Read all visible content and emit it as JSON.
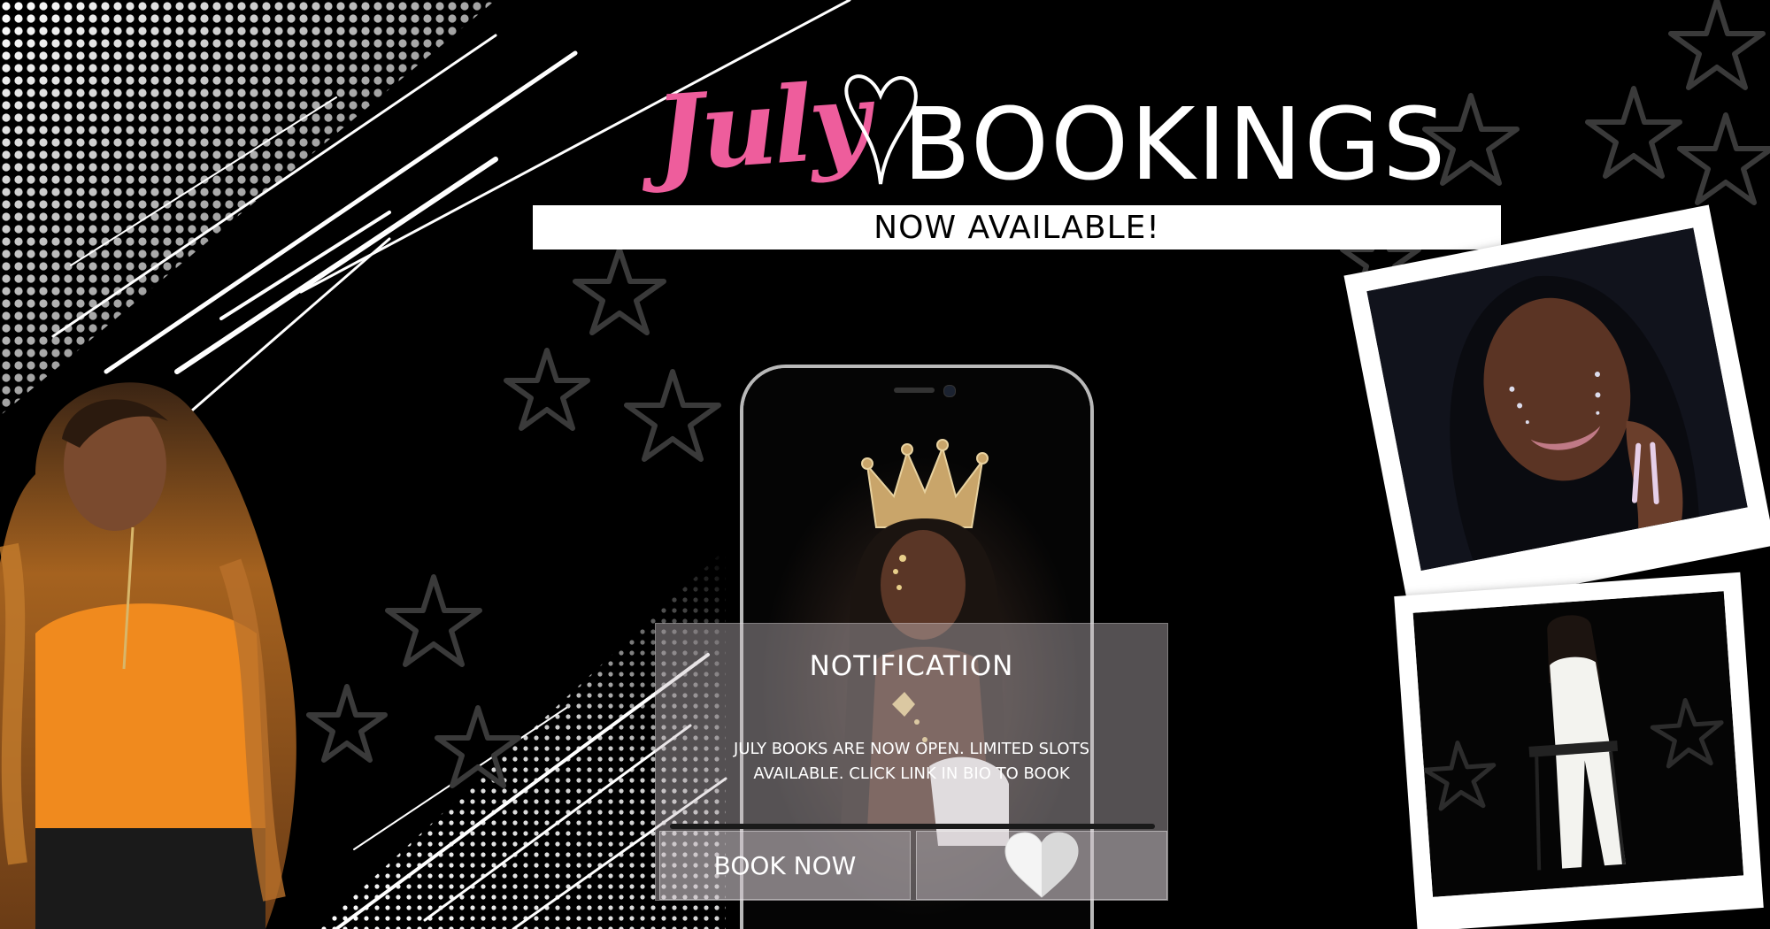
{
  "title": {
    "script_word": "July",
    "main_word": "BOOKINGS",
    "banner": "NOW AVAILABLE!"
  },
  "notification": {
    "title": "NOTIFICATION",
    "body_line1": "JULY BOOKS ARE NOW OPEN. LIMITED SLOTS",
    "body_line2": "AVAILABLE. CLICK LINK IN BIO TO BOOK",
    "book_button": "BOOK NOW"
  },
  "colors": {
    "accent_pink": "#ee5d9c",
    "background": "#000000",
    "text": "#ffffff"
  },
  "icons": [
    "heart-icon",
    "star-icon",
    "crown-icon"
  ]
}
